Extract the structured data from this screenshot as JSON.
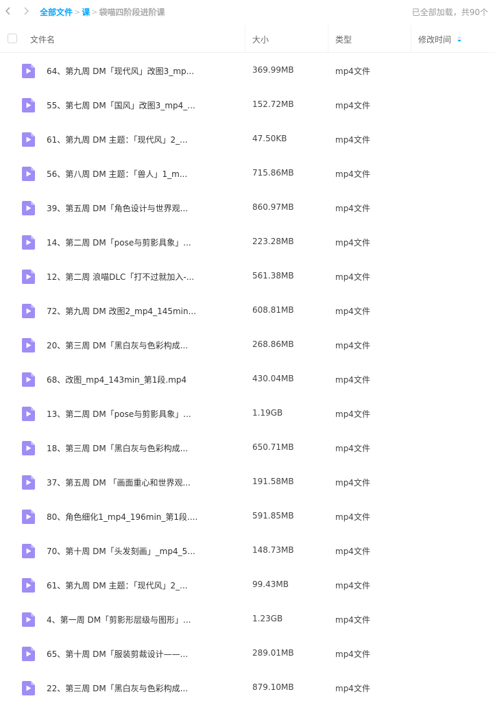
{
  "breadcrumb": {
    "root": "全部文件",
    "sep": ">",
    "parent": "课",
    "current": "袋喵四阶段进阶课"
  },
  "status": {
    "loaded": "已全部加载，共90个"
  },
  "table": {
    "headers": {
      "name": "文件名",
      "size": "大小",
      "type": "类型",
      "modified": "修改时间"
    },
    "rows": [
      {
        "name": "64、第九周 DM「现代风」改图3_mp...",
        "size": "369.99MB",
        "type": "mp4文件"
      },
      {
        "name": "55、第七周 DM「国风」改图3_mp4_...",
        "size": "152.72MB",
        "type": "mp4文件"
      },
      {
        "name": "61、第九周 DM 主题：「现代风」2_...",
        "size": "47.50KB",
        "type": "mp4文件"
      },
      {
        "name": "56、第八周 DM 主题：「兽人」1_m...",
        "size": "715.86MB",
        "type": "mp4文件"
      },
      {
        "name": "39、第五周 DM「角色设计与世界观...",
        "size": "860.97MB",
        "type": "mp4文件"
      },
      {
        "name": "14、第二周 DM「pose与剪影具象」...",
        "size": "223.28MB",
        "type": "mp4文件"
      },
      {
        "name": "12、第二周 浪喵DLC「打不过就加入-...",
        "size": "561.38MB",
        "type": "mp4文件"
      },
      {
        "name": "72、第九周 DM 改图2_mp4_145min...",
        "size": "608.81MB",
        "type": "mp4文件"
      },
      {
        "name": "20、第三周 DM「黑白灰与色彩构成...",
        "size": "268.86MB",
        "type": "mp4文件"
      },
      {
        "name": "68、改图_mp4_143min_第1段.mp4",
        "size": "430.04MB",
        "type": "mp4文件"
      },
      {
        "name": "13、第二周 DM「pose与剪影具象」...",
        "size": "1.19GB",
        "type": "mp4文件"
      },
      {
        "name": "18、第三周 DM「黑白灰与色彩构成...",
        "size": "650.71MB",
        "type": "mp4文件"
      },
      {
        "name": "37、第五周 DM 「画面重心和世界观...",
        "size": "191.58MB",
        "type": "mp4文件"
      },
      {
        "name": "80、角色细化1_mp4_196min_第1段....",
        "size": "591.85MB",
        "type": "mp4文件"
      },
      {
        "name": "70、第十周 DM「头发刻画」_mp4_5...",
        "size": "148.73MB",
        "type": "mp4文件"
      },
      {
        "name": "61、第九周 DM 主题：「现代风」2_...",
        "size": "99.43MB",
        "type": "mp4文件"
      },
      {
        "name": "4、第一周 DM「剪影形层级与图形」...",
        "size": "1.23GB",
        "type": "mp4文件"
      },
      {
        "name": "65、第十周 DM「服装剪裁设计——...",
        "size": "289.01MB",
        "type": "mp4文件"
      },
      {
        "name": "22、第三周 DM「黑白灰与色彩构成...",
        "size": "879.10MB",
        "type": "mp4文件"
      }
    ]
  },
  "colors": {
    "accent": "#06a7ff",
    "video_icon": "#9f8cf5"
  },
  "icons": {
    "back": "chevron-left-icon",
    "forward": "chevron-right-icon",
    "file": "video-file-icon",
    "sort": "sort-icon"
  }
}
